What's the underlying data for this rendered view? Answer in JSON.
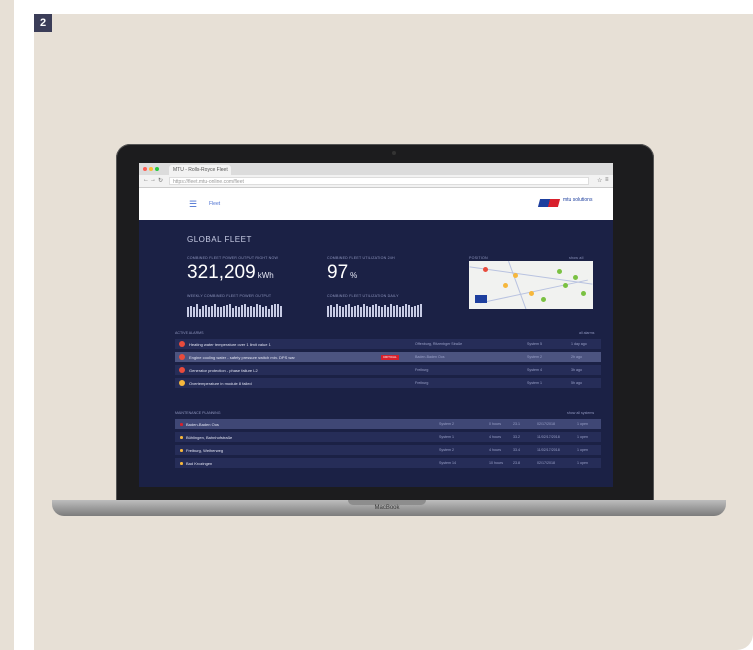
{
  "figure": {
    "number": "2"
  },
  "laptop": {
    "brand": "MacBook"
  },
  "browser": {
    "tab_title": "MTU - Rolls-Royce Fleet",
    "url": "https://fleet.mtu-online.com/fleet"
  },
  "app": {
    "nav_home": "Fleet",
    "logo_text": "mtu solutions"
  },
  "dashboard": {
    "title": "GLOBAL FLEET",
    "kpi1": {
      "label": "COMBINED FLEET POWER OUTPUT RIGHT NOW",
      "value": "321,209",
      "unit": "kWh"
    },
    "kpi2": {
      "label": "COMBINED FLEET UTILIZATION 24H",
      "value": "97",
      "unit": "%"
    },
    "position": {
      "label": "POSITION",
      "link": "show all"
    },
    "chart1": {
      "label": "WEEKLY COMBINED FLEET POWER OUTPUT",
      "bars": [
        0.7,
        0.8,
        0.75,
        0.9,
        0.6,
        0.8,
        0.85,
        0.7,
        0.8,
        0.9,
        0.75,
        0.7,
        0.8,
        0.85,
        0.9,
        0.65,
        0.8,
        0.75,
        0.85,
        0.9,
        0.7,
        0.8,
        0.75,
        0.9,
        0.85,
        0.7,
        0.8,
        0.6,
        0.85,
        0.9,
        0.95,
        0.8
      ]
    },
    "chart2": {
      "label": "COMBINED FLEET UTILIZATION DAILY",
      "bars": [
        0.8,
        0.85,
        0.75,
        0.9,
        0.8,
        0.7,
        0.85,
        0.9,
        0.75,
        0.8,
        0.85,
        0.7,
        0.9,
        0.8,
        0.75,
        0.85,
        0.9,
        0.8,
        0.7,
        0.85,
        0.75,
        0.9,
        0.8,
        0.85,
        0.7,
        0.8,
        0.9,
        0.85,
        0.75,
        0.8,
        0.85,
        0.9
      ]
    }
  },
  "alarms": {
    "title": "ACTIVE ALARMS",
    "link": "all alarms",
    "items": [
      {
        "text": "Heating water temperature over 1 limit value 1",
        "tag": "",
        "location": "Offenburg, Ritzenbger Straße",
        "site": "System 5",
        "time": "1 day ago",
        "icon_color": "#e84b3c",
        "highlight": false
      },
      {
        "text": "Engine cooling water - safety pressure switch min. DPS war",
        "tag": "CRITICAL",
        "location": "Baden-Baden Oos",
        "site": "System 2",
        "time": "2h ago",
        "icon_color": "#e84b3c",
        "highlight": true
      },
      {
        "text": "Generator protection - phase failure L2",
        "tag": "",
        "location": "Freiburg",
        "site": "System 4",
        "time": "3h ago",
        "icon_color": "#e84b3c",
        "highlight": false
      },
      {
        "text": "Overtemperature in module 8 failed",
        "tag": "",
        "location": "Freiburg",
        "site": "System 1",
        "time": "5h ago",
        "icon_color": "#f6b73c",
        "highlight": false
      }
    ]
  },
  "maintenance": {
    "title": "MAINTENANCE PLANNING",
    "link": "show all systems",
    "items": [
      {
        "text": "Baden-Baden Oos",
        "system": "System 2",
        "hours": "0 hours",
        "pct": "23.1",
        "date": "02/17/2018",
        "count": "1 open",
        "dot_color": "#d8202c",
        "highlight": true
      },
      {
        "text": "Bühlingen, Bahnhofstraße",
        "system": "System 1",
        "hours": "4 hours",
        "pct": "33.2",
        "date": "11/02/17/2018",
        "count": "1 open",
        "dot_color": "#f6b73c",
        "highlight": false
      },
      {
        "text": "Freiburg, Weiherweg",
        "system": "System 2",
        "hours": "4 hours",
        "pct": "33.4",
        "date": "11/02/17/2018",
        "count": "1 open",
        "dot_color": "#f6b73c",
        "highlight": false
      },
      {
        "text": "Bad Krozingen",
        "system": "System 14",
        "hours": "10 hours",
        "pct": "23.8",
        "date": "02/17/2018",
        "count": "1 open",
        "dot_color": "#f6b73c",
        "highlight": false
      }
    ]
  },
  "map": {
    "pins": [
      {
        "color": "#e84b3c"
      },
      {
        "color": "#f6b73c"
      },
      {
        "color": "#f6b73c"
      },
      {
        "color": "#7ac142"
      },
      {
        "color": "#7ac142"
      },
      {
        "color": "#7ac142"
      },
      {
        "color": "#f6b73c"
      },
      {
        "color": "#7ac142"
      },
      {
        "color": "#7ac142"
      }
    ],
    "legend_color": "#1e3f9e"
  }
}
